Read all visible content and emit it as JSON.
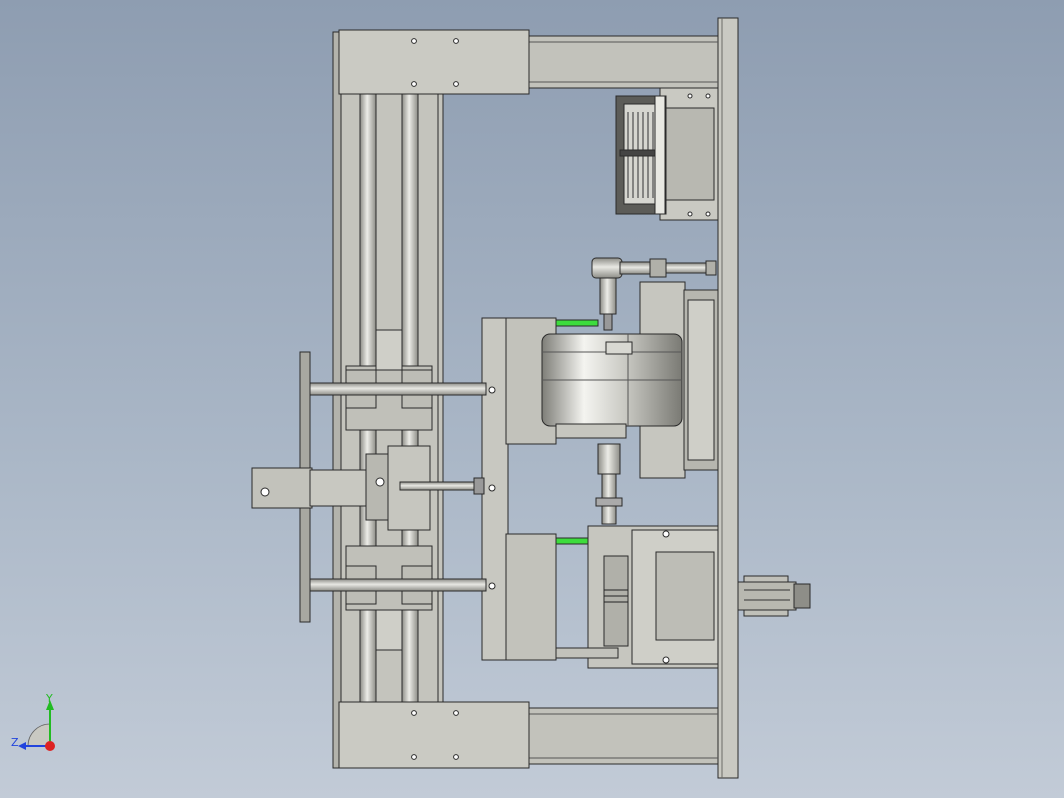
{
  "viewport": {
    "background_top": "#8e9db1",
    "background_bottom": "#c2cbd7"
  },
  "model": {
    "steel_color": "#c4c4bd",
    "steel_dark": "#9a9a93",
    "edge_color": "#2a2a2a",
    "highlight_color": "#3ddc3d",
    "motor_color": "#b8b8b0"
  },
  "triad": {
    "x_label": "",
    "y_label": "Y",
    "z_label": "Z",
    "y_color": "#22bb22",
    "z_color": "#2244dd",
    "x_color": "#dd2222"
  }
}
